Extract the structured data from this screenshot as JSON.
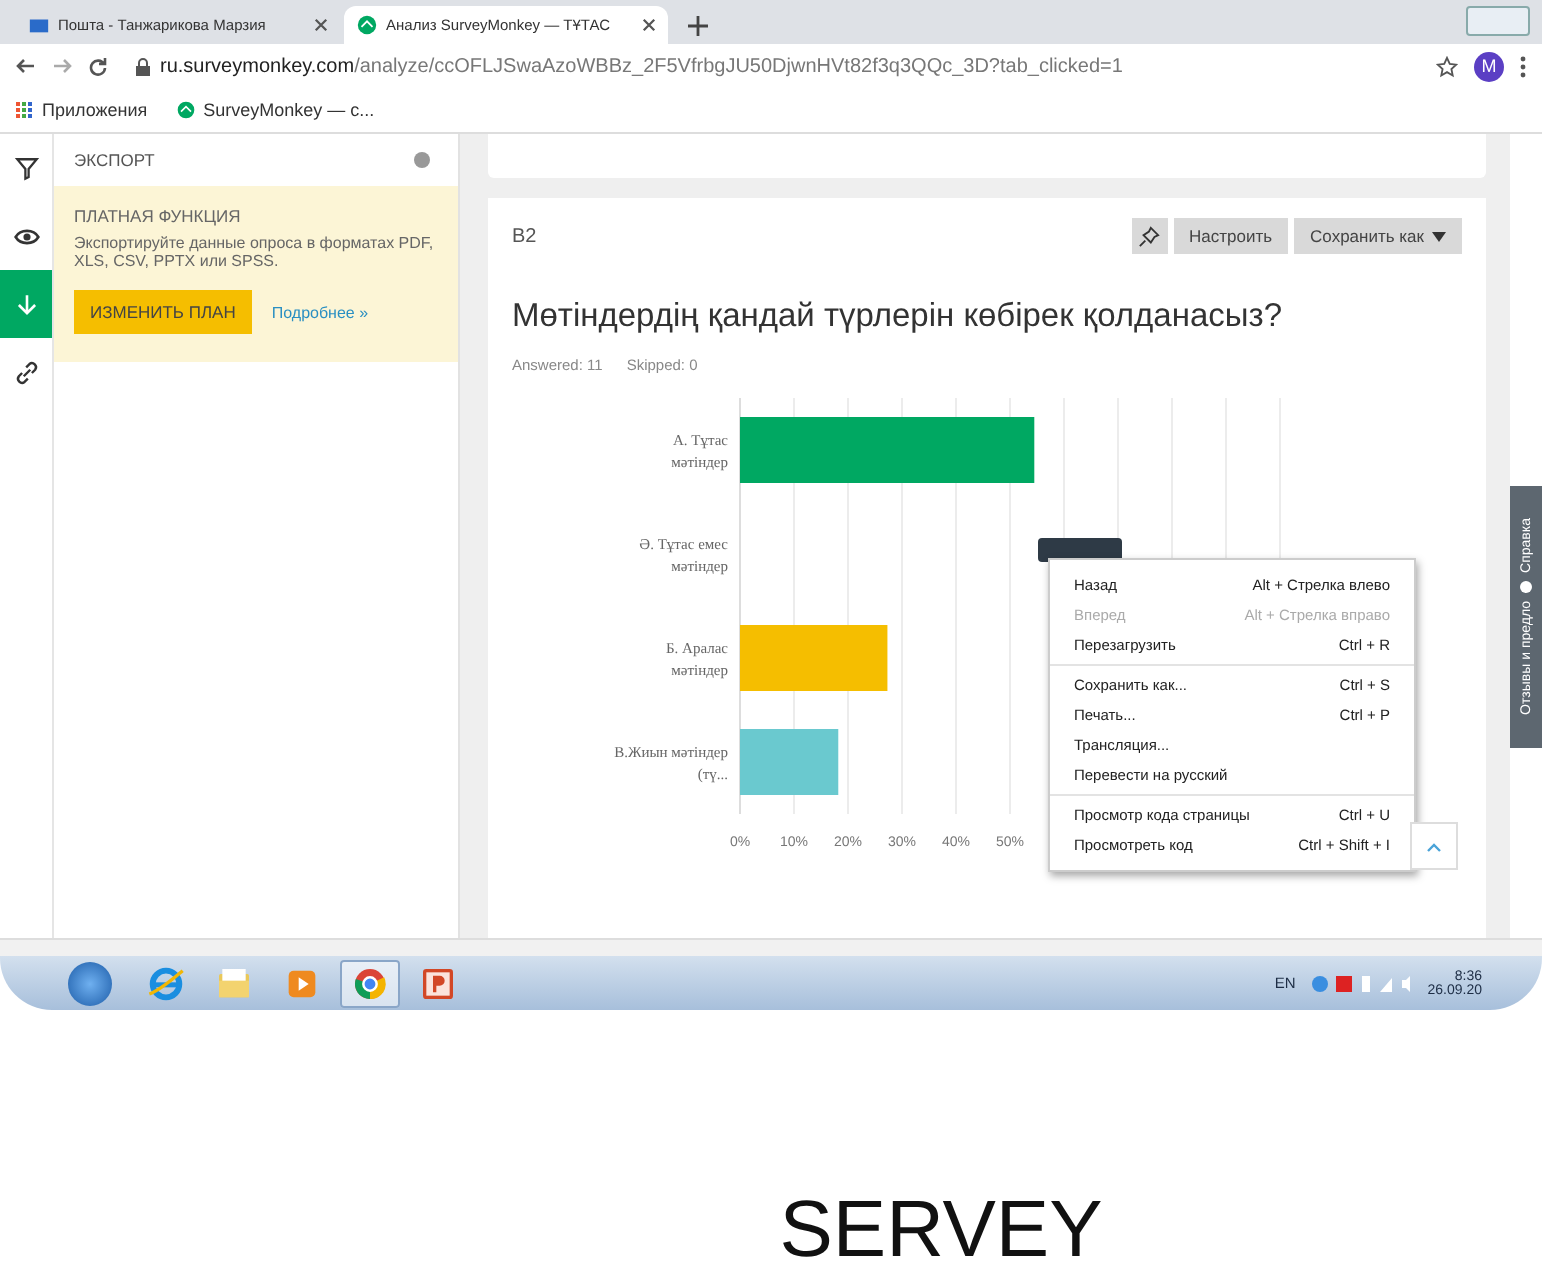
{
  "browser": {
    "tabs": [
      {
        "title": "Пошта - Танжарикова Марзия",
        "selected": false
      },
      {
        "title": "Анализ SurveyMonkey — ТҰТАС",
        "selected": true
      }
    ],
    "url_host": "ru.surveymonkey.com",
    "url_path": "/analyze/ccOFLJSwaAzoWBBz_2F5VfrbgJU50DjwnHVt82f3q3QQc_3D?tab_clicked=1",
    "profile_initial": "M",
    "bookmarks": [
      {
        "kind": "apps",
        "label": "Приложения"
      },
      {
        "kind": "site",
        "label": "SurveyMonkey — с..."
      }
    ]
  },
  "rail": [
    {
      "kind": "filter",
      "selected": false
    },
    {
      "kind": "eye",
      "selected": false
    },
    {
      "kind": "download",
      "selected": true
    },
    {
      "kind": "link",
      "selected": false
    }
  ],
  "sidebar": {
    "heading": "ЭКСПОРТ",
    "notice": {
      "title": "ПЛАТНАЯ ФУНКЦИЯ",
      "text": "Экспортируйте данные опроса в форматах PDF, XLS, CSV, PPTX или SPSS.",
      "button": "ИЗМЕНИТЬ ПЛАН",
      "link": "Подробнее »"
    }
  },
  "question": {
    "number": "В2",
    "buttons": [
      "Настроить",
      "Сохранить как"
    ],
    "title": "Мөтіндердің қандай түрлерін көбірек қолданасыз?",
    "answered": "Answered: 11",
    "skipped": "Skipped: 0",
    "chart_data": {
      "type": "bar",
      "orientation": "horizontal",
      "categories": [
        "А. Тұтас мәтіндер",
        "Ә. Тұтас емес мәтіндер",
        "Б. Аралас мәтіндер",
        "В.Жиын мәтіндер (тү..."
      ],
      "series": [
        {
          "values": [
            54.5,
            0,
            27.3,
            18.2
          ],
          "colors": [
            "#00a862",
            null,
            "#f5be00",
            "#6ac9cf"
          ]
        }
      ],
      "grid": true,
      "xlim": [
        0,
        100
      ],
      "xticks": [
        {
          "value": 0,
          "label": "0%"
        },
        {
          "value": 10,
          "label": "10%"
        },
        {
          "value": 20,
          "label": "20%"
        },
        {
          "value": 30,
          "label": "30%"
        },
        {
          "value": 40,
          "label": "40%"
        },
        {
          "value": 50,
          "label": "50%"
        }
      ]
    }
  },
  "context_menu": [
    [
      {
        "label": "Назад",
        "shortcut": "Alt + Стрелка влево",
        "disabled": false
      },
      {
        "label": "Вперед",
        "shortcut": "Alt + Стрелка вправо",
        "disabled": true
      },
      {
        "label": "Перезагрузить",
        "shortcut": "Ctrl + R",
        "disabled": false
      }
    ],
    [
      {
        "label": "Сохранить как...",
        "shortcut": "Ctrl + S",
        "disabled": false
      },
      {
        "label": "Печать...",
        "shortcut": "Ctrl + P",
        "disabled": false
      },
      {
        "label": "Трансляция...",
        "disabled": false
      },
      {
        "label": "Перевести на русский",
        "disabled": false
      }
    ],
    [
      {
        "label": "Просмотр кода страницы",
        "shortcut": "Ctrl + U",
        "disabled": false
      },
      {
        "label": "Просмотреть код",
        "shortcut": "Ctrl + Shift + I",
        "disabled": false
      }
    ]
  ],
  "feedback_tab": [
    "Отзывы и предло",
    "Справка"
  ],
  "taskbar": {
    "apps": [
      {
        "kind": "ie",
        "selected": false
      },
      {
        "kind": "folder",
        "selected": false
      },
      {
        "kind": "player",
        "selected": false
      },
      {
        "kind": "chrome",
        "selected": true
      },
      {
        "kind": "powerpoint",
        "selected": false
      }
    ],
    "language": "EN",
    "time": "8:36",
    "date": "26.09.20"
  },
  "caption": "SERVEY"
}
